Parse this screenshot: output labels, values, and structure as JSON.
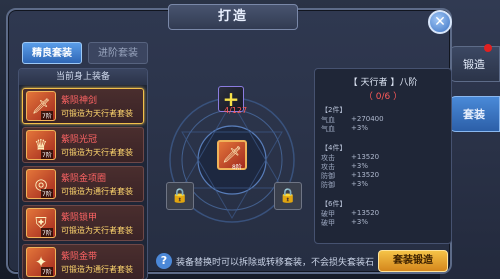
{
  "dialog": {
    "title": "打造"
  },
  "tabs": [
    {
      "label": "精良套装"
    },
    {
      "label": "进阶套装"
    }
  ],
  "left_panel": {
    "header": "当前身上装备",
    "items": [
      {
        "name": "紫陨神剑",
        "desc": "可锻造为天行者套装",
        "level": "7阶"
      },
      {
        "name": "紫陨光冠",
        "desc": "可锻造为天行者套装",
        "level": "7阶"
      },
      {
        "name": "紫陨金项圈",
        "desc": "可锻造为通行者套装",
        "level": "7阶"
      },
      {
        "name": "紫陨锁甲",
        "desc": "可锻造为天行者套装",
        "level": "7阶"
      },
      {
        "name": "紫陨金带",
        "desc": "可锻造为通行者套装",
        "level": "7阶"
      }
    ]
  },
  "center": {
    "material_icon": "plus-icon",
    "material_count": "4/127",
    "forge_item_level": "8阶"
  },
  "right_panel": {
    "set_title": "【 天行者 】八阶",
    "set_count": "（ 0/6 ）",
    "bonuses": [
      {
        "head": "【2件】",
        "rows": [
          {
            "k": "气血",
            "v": "+270400"
          },
          {
            "k": "气血",
            "v": "+3%"
          }
        ]
      },
      {
        "head": "【4件】",
        "rows": [
          {
            "k": "攻击",
            "v": "+13520"
          },
          {
            "k": "攻击",
            "v": "+3%"
          },
          {
            "k": "防御",
            "v": "+13520"
          },
          {
            "k": "防御",
            "v": "+3%"
          }
        ]
      },
      {
        "head": "【6件】",
        "rows": [
          {
            "k": "破甲",
            "v": "+13520"
          },
          {
            "k": "破甲",
            "v": "+3%"
          }
        ]
      }
    ]
  },
  "footer": {
    "text": "装备替换时可以拆除或转移套装，不会损失套装石",
    "confirm_label": "套装锻造"
  },
  "side_tabs": [
    {
      "label": "锻造"
    },
    {
      "label": "套装"
    }
  ],
  "colors": {
    "accent": "#4b88d8",
    "confirm": "#f5c347",
    "warning_red": "#ff5a5a"
  }
}
